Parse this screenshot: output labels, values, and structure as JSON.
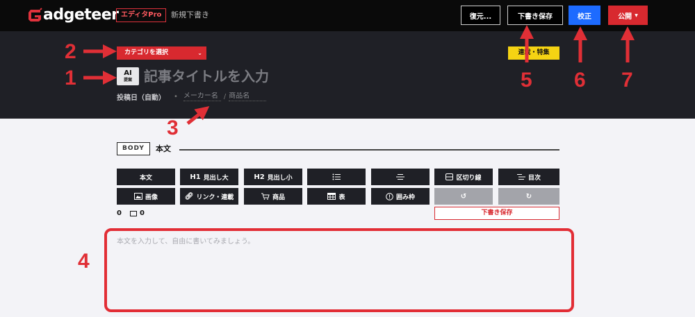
{
  "topbar": {
    "logo_text": "adgeteer",
    "pro_badge": "エディタPro",
    "status": "新規下書き",
    "restore_label": "復元...",
    "draft_save_label": "下書き保存",
    "proof_label": "校正",
    "publish_label": "公開",
    "colors": {
      "accent": "#d8292f",
      "proof": "#1d6bff"
    }
  },
  "header": {
    "category_label": "カテゴリを選択",
    "series_label": "連載・特集",
    "ai_label": "AI",
    "ai_sub": "提案",
    "title_placeholder": "記事タイトルを入力",
    "post_date": "投稿日（自動）",
    "maker_placeholder": "メーカー名",
    "product_placeholder": "商品名"
  },
  "annotations": [
    "1",
    "2",
    "3",
    "4",
    "5",
    "6",
    "7"
  ],
  "body": {
    "label": "BODY",
    "title": "本文",
    "toolbar_row1": [
      {
        "label": "本文",
        "icon": ""
      },
      {
        "label": "見出し大",
        "icon": "H1"
      },
      {
        "label": "見出し小",
        "icon": "H2"
      },
      {
        "label": "",
        "icon": "bullet-list-icon"
      },
      {
        "label": "",
        "icon": "numbered-list-icon"
      },
      {
        "label": "区切り線",
        "icon": "divider-icon"
      },
      {
        "label": "目次",
        "icon": "toc-icon"
      }
    ],
    "toolbar_row2": [
      {
        "label": "画像",
        "icon": "image-icon"
      },
      {
        "label": "リンク・連載",
        "icon": "link-icon"
      },
      {
        "label": "商品",
        "icon": "cart-icon"
      },
      {
        "label": "表",
        "icon": "table-icon"
      },
      {
        "label": "囲み枠",
        "icon": "alert-icon"
      },
      {
        "label": "",
        "icon": "undo-icon"
      },
      {
        "label": "",
        "icon": "redo-icon"
      }
    ],
    "char_count": "0",
    "image_count": "0",
    "draft_save_label": "下書き保存",
    "editor_placeholder": "本文を入力して、自由に書いてみましょう。"
  }
}
